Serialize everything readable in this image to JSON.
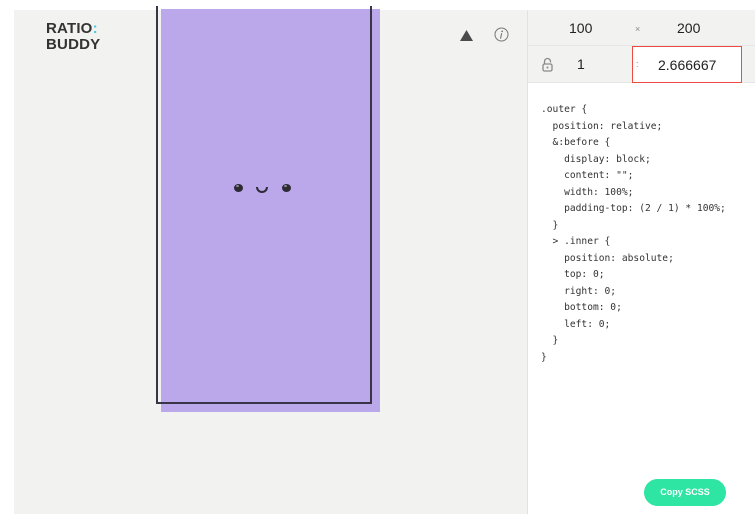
{
  "app": {
    "logo_line1": "RATIO",
    "logo_colon": ":",
    "logo_line2": "BUDDY"
  },
  "toolbar": {
    "icons": [
      "triangle-icon",
      "info-icon"
    ]
  },
  "dimensions": {
    "width": "100",
    "times_symbol": "×",
    "height": "200",
    "lock_icon": "lock-icon",
    "ratio_left": "1",
    "ratio_colon": ":",
    "ratio_right": "2.666667"
  },
  "code": {
    "text": ".outer {\n  position: relative;\n  &:before {\n    display: block;\n    content: \"\";\n    width: 100%;\n    padding-top: (2 / 1) * 100%;\n  }\n  > .inner {\n    position: absolute;\n    top: 0;\n    right: 0;\n    bottom: 0;\n    left: 0;\n  }\n}"
  },
  "actions": {
    "copy_label": "Copy SCSS"
  },
  "colors": {
    "accent_colon": "#47c8e6",
    "box_fill": "#bba8ea",
    "highlight_border": "#ee4b43",
    "button": "#2ee5a3"
  }
}
